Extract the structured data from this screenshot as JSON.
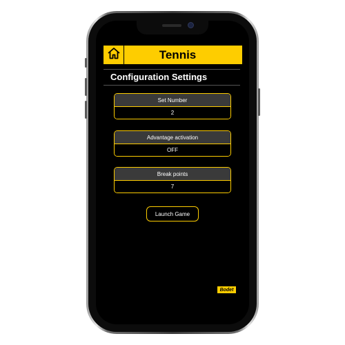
{
  "app": {
    "title": "Tennis",
    "accent_color": "#fecd00",
    "home_icon": "home-icon"
  },
  "config": {
    "title": "Configuration Settings",
    "settings": [
      {
        "label": "Set Number",
        "value": "2"
      },
      {
        "label": "Advantage activation",
        "value": "OFF"
      },
      {
        "label": "Break points",
        "value": "7"
      }
    ],
    "launch_label": "Launch Game"
  },
  "brand": {
    "logo_text": "Bodet"
  }
}
